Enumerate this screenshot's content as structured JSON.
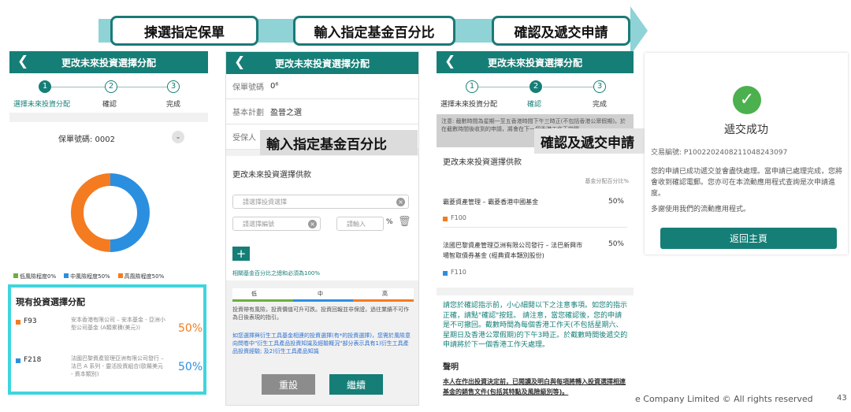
{
  "steps_banner": {
    "step1": "揀選指定保單",
    "step2": "輸入指定基金百分比",
    "step3": "確認及遞交申請"
  },
  "panel1": {
    "header": "更改未來投資選擇分配",
    "back_icon": "chevron-left-icon",
    "steps": [
      {
        "num": "1",
        "label": "選擇未來投資分配"
      },
      {
        "num": "2",
        "label": "確認"
      },
      {
        "num": "3",
        "label": "完成"
      }
    ],
    "policy_label": "保單號碼: 0002",
    "chevron_icon": "chevron-down-icon",
    "donut": {
      "orange_pct": 50,
      "blue_pct": 50,
      "orange": "#f47b20",
      "blue": "#2b8fe0"
    },
    "legend": [
      {
        "label": "低風險程度0%",
        "color": "#6aaf3f"
      },
      {
        "label": "中風險程度50%",
        "color": "#2b8fe0"
      },
      {
        "label": "高風險程度50%",
        "color": "#f47b20"
      }
    ],
    "existing_title": "現有投資選擇分配",
    "funds": [
      {
        "code": "F93",
        "name": "安本香港有限公司 – 安本基金 - 亞洲小型公司基金 (A類累積(美元))",
        "pct": "50%",
        "color": "#f47b20"
      },
      {
        "code": "F218",
        "name": "法國巴黎資產管理亞洲有限公司發行 – 法巴 A 系列 - 靈活投資組合(歐羅美元 - 資本類別)",
        "pct": "50%",
        "color": "#2b8fe0"
      }
    ]
  },
  "panel2": {
    "header": "更改未來投資選擇分配",
    "back_icon": "chevron-left-icon",
    "policy_key": "保單號碼",
    "policy_val": "0⁶",
    "plan_key": "基本計劃",
    "plan_val": "盈晉之選",
    "insured_key": "受保人",
    "overlay": "輸入指定基金百分比",
    "section_title": "更改未來投資選擇供款",
    "select_placeholder": "請選擇投資選擇",
    "code_placeholder": "請選擇編號",
    "pct_placeholder": "請輸入",
    "pct_unit": "%",
    "trash_icon": "trash-icon",
    "add_icon": "plus-icon",
    "sum_note": "相關基金百分比之總和必須為100%",
    "risk_labels": [
      "低",
      "中",
      "高"
    ],
    "risk_colors": [
      "#6aaf3f",
      "#2b8fe0",
      "#f47b20"
    ],
    "disclaimer1": "投資帶有風險，投資價值可升可跌。投資回報並非保證，過往業績不可作為日後表現的指引。",
    "disclaimer2": "如您選擇與衍生工具基金相連的投資選擇(有*的投資選擇)，您需於風險意向問卷中\"衍生工具產品投資知識及經驗概況\"部分表示具有1)衍生工具產品投資經驗; 及2)衍生工具產品知識",
    "reset_label": "重設",
    "continue_label": "繼續"
  },
  "panel3": {
    "header": "更改未來投資選擇分配",
    "back_icon": "chevron-left-icon",
    "steps": [
      {
        "num": "1",
        "label": "選擇未來投資分配"
      },
      {
        "num": "2",
        "label": "確認"
      },
      {
        "num": "3",
        "label": "完成"
      }
    ],
    "notice": "注意: 截數時間為星期一至五香港時間下午三時正(不包括香港公眾假期)。於在截數時間後收到的申請，將會在下一個香港工作天辦理。",
    "overlay": "確認及遞交申請",
    "section_title": "更改未來投資選擇供款",
    "col_header": "基金分配百分比%",
    "funds": [
      {
        "name": "霸菱資產管理 – 霸菱香港中國基金",
        "pct": "50%",
        "code": "F100",
        "color": "#f47b20"
      },
      {
        "name": "法國巴黎資產管理亞洲有限公司發行 – 法巴新興市場智取債券基金 (經典資本類別股份)",
        "pct": "50%",
        "code": "F110",
        "color": "#2b8fe0"
      }
    ],
    "confirm_note": "請您於確認指示前，小心細閱以下之注意事項。如您的指示正確，請點\"確認\"按鈕。 請注意，當您確認後，您的申請是不可撤回。截數時間為每個香港工作天(不包括星期六、星期日及香港公眾假期)的下午3時正。於截數時間後遞交的申請將於下一個香港工作天處理。",
    "declaration_title": "聲明",
    "declaration": "本人在作出投資決定前，已閱讀及明白與每項將轉入投資選擇相連基金的銷售文件(包括其特點及風險級別等)。"
  },
  "panel4": {
    "check_icon": "check-circle-icon",
    "title": "遞交成功",
    "ref": "交易編號: P10022024082110482430​97",
    "message": "您的申請已成功遞交並會盡快處理。當申請已處理完成，您將會收到確認電郵。您亦可在本流動應用程式查詢是次申請進度。",
    "thanks": "多謝使用我們的流動應用程式。",
    "home_label": "返回主頁"
  },
  "footer": {
    "copyright": "e Company Limited © All rights reserved",
    "page": "43"
  },
  "colors": {
    "teal": "#157e77",
    "teal_light": "#8fd3d6",
    "highlight": "#3fd5dd"
  }
}
